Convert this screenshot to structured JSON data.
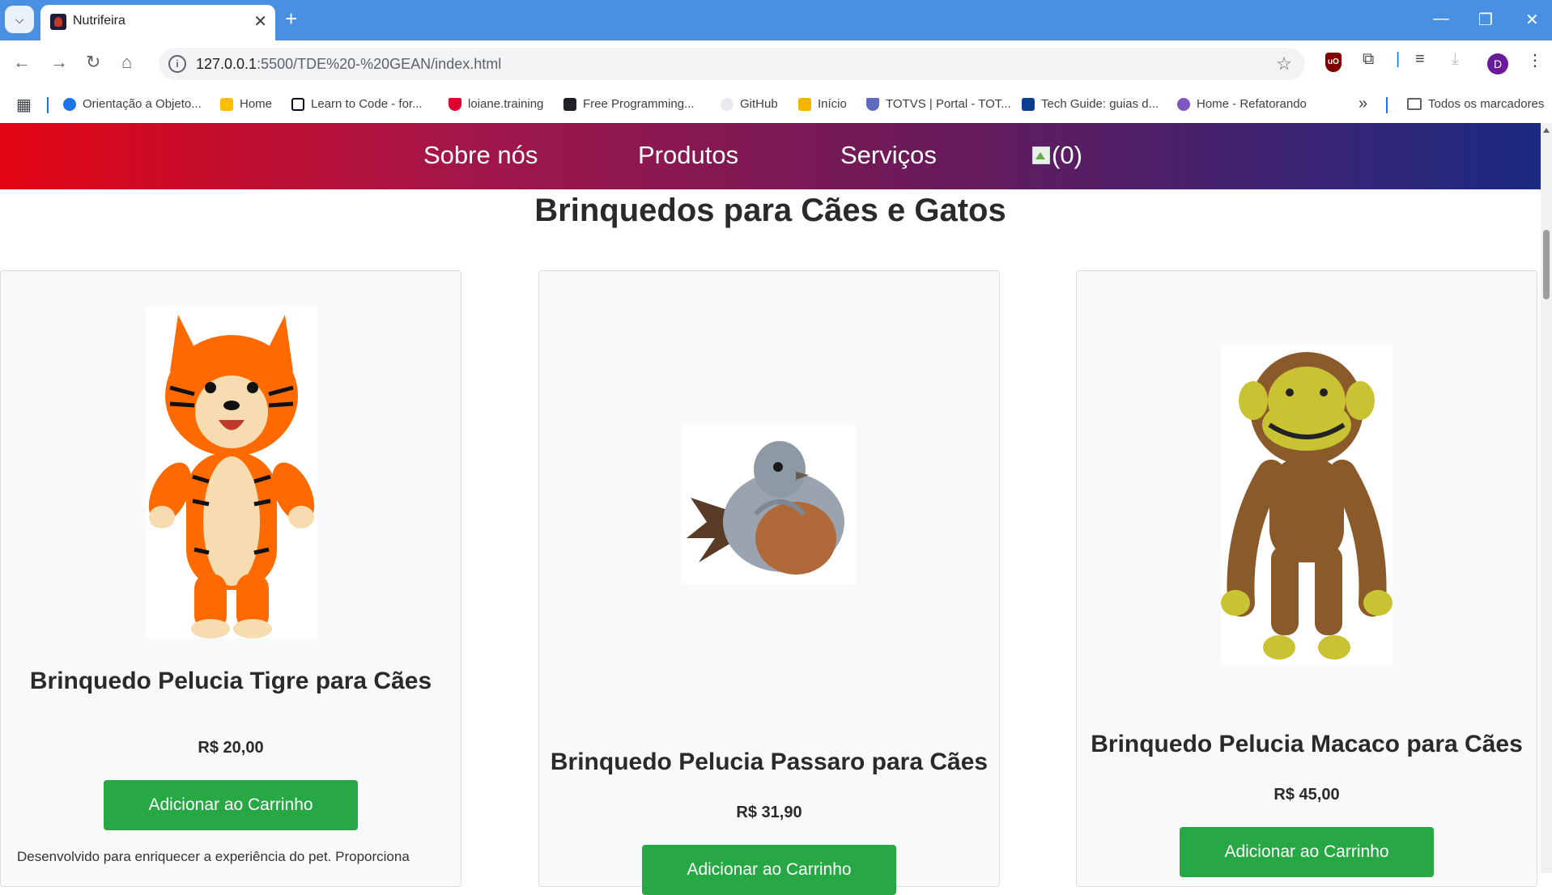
{
  "browser": {
    "tab_title": "Nutrifeira",
    "url_host": "127.0.0.1",
    "url_path": ":5500/TDE%20-%20GEAN/index.html",
    "profile_initial": "D",
    "bookmarks": [
      {
        "label": "Orientação a Objeto...",
        "icon": "c-icon",
        "color": "#1a73e8"
      },
      {
        "label": "Home",
        "icon": "pinwheel-icon",
        "color": "#fbbc04"
      },
      {
        "label": "Learn to Code - for...",
        "icon": "freecodecamp-icon",
        "color": "#0a0a23"
      },
      {
        "label": "loiane.training",
        "icon": "angular-icon",
        "color": "#dd0031"
      },
      {
        "label": "Free Programming...",
        "icon": "book-icon",
        "color": "#202124"
      },
      {
        "label": "GitHub",
        "icon": "github-icon",
        "color": "#e8eaed"
      },
      {
        "label": "Início",
        "icon": "classroom-icon",
        "color": "#f4b400"
      },
      {
        "label": "TOTVS | Portal - TOT...",
        "icon": "shield-icon",
        "color": "#5c6bc0"
      },
      {
        "label": "Tech Guide: guias d...",
        "icon": "t-icon",
        "color": "#0b3d91"
      },
      {
        "label": "Home - Refatorando",
        "icon": "refatorando-icon",
        "color": "#7e57c2"
      }
    ],
    "more_bookmarks": "»",
    "all_bookmarks": "Todos os marcadores"
  },
  "nav": {
    "about": "Sobre nós",
    "products": "Produtos",
    "services": "Serviços",
    "cart_count": "(0)"
  },
  "section": {
    "title": "Brinquedos para Cães e Gatos"
  },
  "products": [
    {
      "name": "Brinquedo Pelucia Tigre para Cães",
      "price": "R$ 20,00",
      "button": "Adicionar ao Carrinho",
      "description": "Desenvolvido para enriquecer a experiência do pet. Proporciona"
    },
    {
      "name": "Brinquedo Pelucia Passaro para Cães",
      "price": "R$ 31,90",
      "button": "Adicionar ao Carrinho"
    },
    {
      "name": "Brinquedo Pelucia Macaco para Cães",
      "price": "R$ 45,00",
      "button": "Adicionar ao Carrinho"
    }
  ],
  "colors": {
    "button_green": "#28a745",
    "nav_gradient_start": "#e30613",
    "nav_gradient_end": "#1b2a82",
    "chrome_blue": "#4a90e2"
  }
}
